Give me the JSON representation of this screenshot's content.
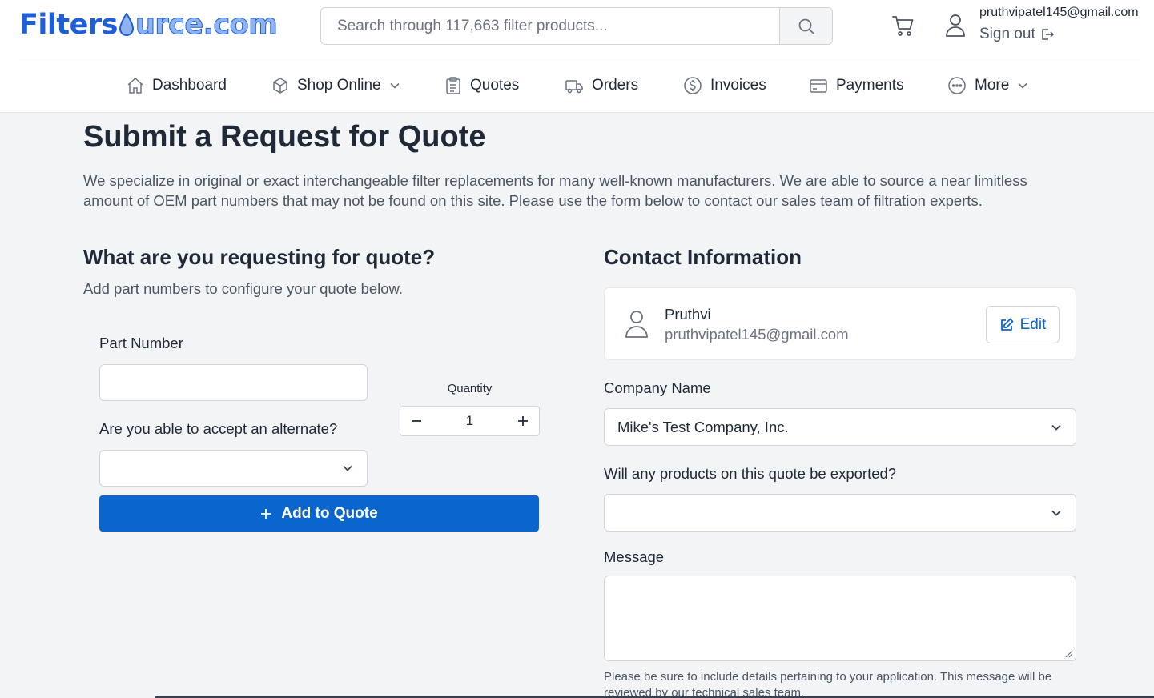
{
  "header": {
    "logo": {
      "part1": "Filters",
      "part2": "urce.com"
    },
    "search": {
      "placeholder": "Search through 117,663 filter products..."
    },
    "user": {
      "email": "pruthvipatel145@gmail.com",
      "signout_label": "Sign out"
    }
  },
  "nav": {
    "items": [
      {
        "label": "Dashboard",
        "icon": "home-icon"
      },
      {
        "label": "Shop Online",
        "icon": "box-icon",
        "dropdown": true
      },
      {
        "label": "Quotes",
        "icon": "clipboard-icon"
      },
      {
        "label": "Orders",
        "icon": "truck-icon"
      },
      {
        "label": "Invoices",
        "icon": "dollar-circle-icon"
      },
      {
        "label": "Payments",
        "icon": "credit-card-icon"
      },
      {
        "label": "More",
        "icon": "ellipsis-circle-icon",
        "dropdown": true
      }
    ]
  },
  "page": {
    "title": "Submit a Request for Quote",
    "intro": "We specialize in original or exact interchangeable filter replacements for many well-known manufacturers. We are able to source a near limitless amount of OEM part numbers that may not be found on this site. Please use the form below to contact our sales team of filtration experts."
  },
  "quote_form": {
    "heading": "What are you requesting for quote?",
    "subheading": "Add part numbers to configure your quote below.",
    "part_number_label": "Part Number",
    "part_number_value": "",
    "quantity_label": "Quantity",
    "quantity_value": "1",
    "alternate_label": "Are you able to accept an alternate?",
    "alternate_value": "",
    "add_button_label": "Add to Quote"
  },
  "contact": {
    "heading": "Contact Information",
    "name": "Pruthvi",
    "email": "pruthvipatel145@gmail.com",
    "edit_label": "Edit",
    "company_label": "Company Name",
    "company_value": "Mike's Test Company, Inc.",
    "export_label": "Will any products on this quote be exported?",
    "export_value": "",
    "message_label": "Message",
    "message_hint": "Please be sure to include details pertaining to your application. This message will be reviewed by our technical sales team."
  },
  "colors": {
    "primary": "#0a66cc",
    "logo_blue": "#1d5fd8",
    "background": "#f3f4f6"
  }
}
